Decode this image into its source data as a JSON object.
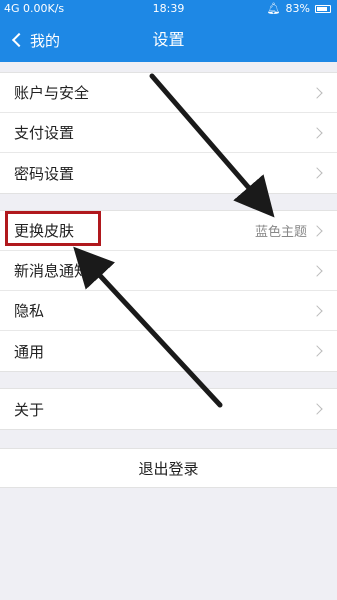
{
  "status_bar": {
    "network": "4G 0.00K/s",
    "time": "18:39",
    "battery": "83%"
  },
  "nav": {
    "back_label": "我的",
    "title": "设置"
  },
  "groups": [
    {
      "items": [
        {
          "label": "账户与安全"
        },
        {
          "label": "支付设置"
        },
        {
          "label": "密码设置"
        }
      ]
    },
    {
      "items": [
        {
          "label": "更换皮肤",
          "value": "蓝色主题"
        },
        {
          "label": "新消息通知"
        },
        {
          "label": "隐私"
        },
        {
          "label": "通用"
        }
      ]
    },
    {
      "items": [
        {
          "label": "关于"
        }
      ]
    }
  ],
  "logout_label": "退出登录",
  "colors": {
    "accent": "#1e88e5",
    "highlight": "#b0181d",
    "annotation": "#1a1a1a"
  }
}
